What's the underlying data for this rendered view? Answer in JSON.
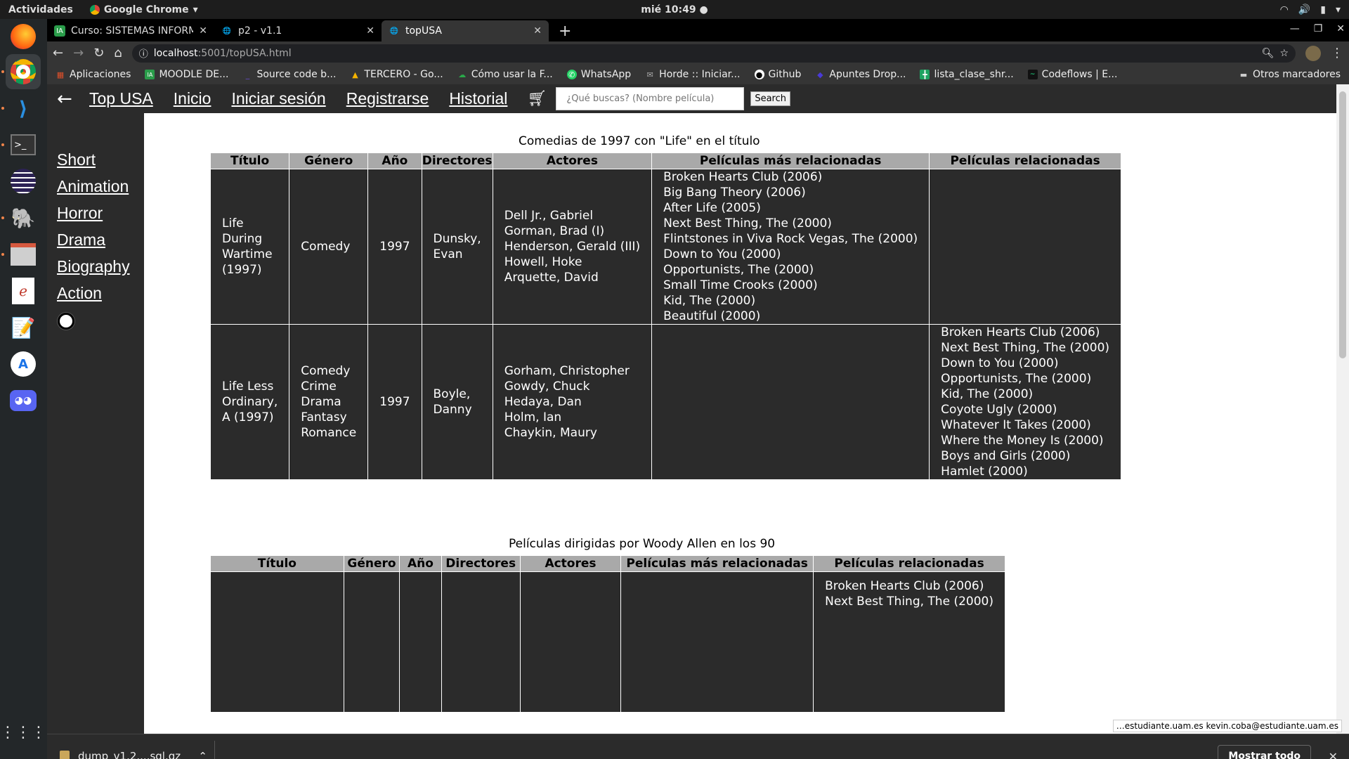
{
  "system": {
    "activities": "Actividades",
    "app_name": "Google Chrome",
    "clock": "mié 10:49 ●"
  },
  "browser": {
    "tabs": [
      {
        "title": "Curso: SISTEMAS INFORM",
        "favicon": "moodle-icon"
      },
      {
        "title": "p2 - v1.1",
        "favicon": "globe-icon"
      },
      {
        "title": "topUSA",
        "favicon": "globe-icon"
      }
    ],
    "url_host": "localhost",
    "url_path": ":5001/topUSA.html",
    "bookmarks": [
      {
        "label": "Aplicaciones",
        "icon": "apps-grid-icon",
        "color": "#e0502a"
      },
      {
        "label": "MOODLE DE...",
        "icon": "moodle-icon",
        "color": "#2a9d4a"
      },
      {
        "label": "Source code b...",
        "icon": "underline-icon",
        "color": "#6b4fd8"
      },
      {
        "label": "TERCERO - Go...",
        "icon": "drive-icon",
        "color": "#f5b400"
      },
      {
        "label": "Cómo usar la F...",
        "icon": "cloud-icon",
        "color": "#2aa84a"
      },
      {
        "label": "WhatsApp",
        "icon": "whatsapp-icon",
        "color": "#25d366"
      },
      {
        "label": "Horde :: Iniciar...",
        "icon": "mail-icon",
        "color": "#aaaaaa"
      },
      {
        "label": "Github",
        "icon": "github-icon",
        "color": "#ffffff"
      },
      {
        "label": "Apuntes Drop...",
        "icon": "dropbox-icon",
        "color": "#4a3ad8"
      },
      {
        "label": "lista_clase_shr...",
        "icon": "sheets-icon",
        "color": "#1ea362"
      },
      {
        "label": "Codeflows | E...",
        "icon": "codeflows-icon",
        "color": "#111111"
      }
    ],
    "other_bookmarks": "Otros marcadores"
  },
  "site": {
    "nav": [
      "Top USA",
      "Inicio",
      "Iniciar sesión",
      "Registrarse",
      "Historial"
    ],
    "search_placeholder": "¿Qué buscas? (Nombre película)",
    "search_button": "Search",
    "genres": [
      "Short",
      "Animation",
      "Horror",
      "Drama",
      "Biography",
      "Action"
    ]
  },
  "table1": {
    "caption": "Comedias de 1997 con \"Life\" en el título",
    "headers": [
      "Título",
      "Género",
      "Año",
      "Directores",
      "Actores",
      "Películas más relacionadas",
      "Películas relacionadas"
    ],
    "rows": [
      {
        "title": "Life During Wartime (1997)",
        "genres": [
          "Comedy"
        ],
        "year": "1997",
        "directors": "Dunsky, Evan",
        "actors": [
          "Dell Jr., Gabriel",
          "Gorman, Brad (I)",
          "Henderson, Gerald (III)",
          "Howell, Hoke",
          "Arquette, David"
        ],
        "most_related": [
          "Broken Hearts Club (2006)",
          "Big Bang Theory (2006)",
          "After Life (2005)",
          "Next Best Thing, The (2000)",
          "Flintstones in Viva Rock Vegas, The (2000)",
          "Down to You (2000)",
          "Opportunists, The (2000)",
          "Small Time Crooks (2000)",
          "Kid, The (2000)",
          "Beautiful (2000)"
        ],
        "related": []
      },
      {
        "title": "Life Less Ordinary, A (1997)",
        "genres": [
          "Comedy",
          "Crime",
          "Drama",
          "Fantasy",
          "Romance"
        ],
        "year": "1997",
        "directors": "Boyle, Danny",
        "actors": [
          "Gorham, Christopher",
          "Gowdy, Chuck",
          "Hedaya, Dan",
          "Holm, Ian",
          "Chaykin, Maury"
        ],
        "most_related": [],
        "related": [
          "Broken Hearts Club (2006)",
          "Next Best Thing, The (2000)",
          "Down to You (2000)",
          "Opportunists, The (2000)",
          "Kid, The (2000)",
          "Coyote Ugly (2000)",
          "Whatever It Takes (2000)",
          "Where the Money Is (2000)",
          "Boys and Girls (2000)",
          "Hamlet (2000)"
        ]
      }
    ]
  },
  "table2": {
    "caption": "Películas dirigidas por Woody Allen en los 90",
    "headers": [
      "Título",
      "Género",
      "Año",
      "Directores",
      "Actores",
      "Películas más relacionadas",
      "Películas relacionadas"
    ],
    "related_visible": [
      "Broken Hearts Club (2006)",
      "Next Best Thing, The (2000)"
    ]
  },
  "status_url": "…estudiante.uam.es kevin.coba@estudiante.uam.es",
  "downloads": {
    "file": "dump_v1.2....sql.gz",
    "show_all": "Mostrar todo"
  }
}
